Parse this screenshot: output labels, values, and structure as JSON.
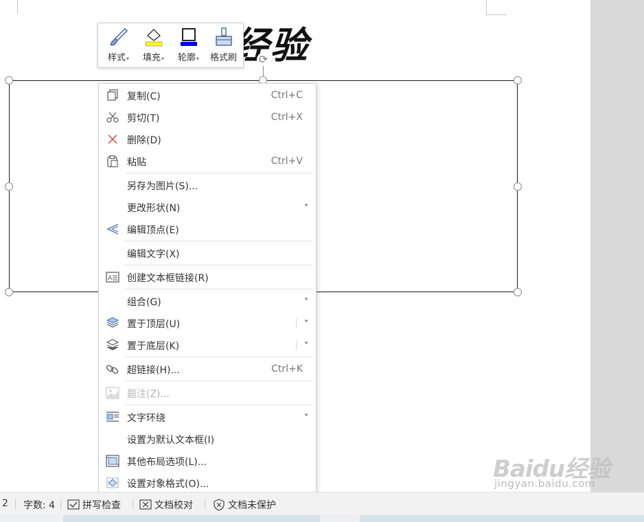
{
  "document": {
    "title_fragment": "经验"
  },
  "mini_toolbar": {
    "buttons": [
      {
        "label": "样式",
        "icon": "brush-icon",
        "has_caret": true
      },
      {
        "label": "填充",
        "icon": "fill-bucket-icon",
        "has_caret": true,
        "accent": "#ffff00"
      },
      {
        "label": "轮廓",
        "icon": "outline-icon",
        "has_caret": true,
        "accent": "#0000ff"
      },
      {
        "label": "格式刷",
        "icon": "format-painter-icon",
        "has_caret": false
      }
    ],
    "caret_glyph": "▾"
  },
  "context_menu": {
    "items": [
      {
        "label": "复制(C)",
        "shortcut": "Ctrl+C",
        "icon": "copy-icon"
      },
      {
        "label": "剪切(T)",
        "shortcut": "Ctrl+X",
        "icon": "scissors-icon"
      },
      {
        "label": "删除(D)",
        "shortcut": "",
        "icon": "delete-x-icon",
        "icon_color": "#e04040"
      },
      {
        "label": "粘贴",
        "shortcut": "Ctrl+V",
        "icon": "paste-icon"
      },
      {
        "label": "另存为图片(S)...",
        "shortcut": "",
        "icon": ""
      },
      {
        "label": "更改形状(N)",
        "shortcut": "",
        "icon": "",
        "submenu": true
      },
      {
        "label": "编辑顶点(E)",
        "shortcut": "",
        "icon": "edit-points-icon"
      },
      {
        "label": "编辑文字(X)",
        "shortcut": "",
        "icon": ""
      },
      {
        "label": "创建文本框链接(R)",
        "shortcut": "",
        "icon": "textbox-link-icon"
      },
      {
        "label": "组合(G)",
        "shortcut": "",
        "icon": "",
        "submenu": true
      },
      {
        "label": "置于顶层(U)",
        "shortcut": "",
        "icon": "bring-to-front-icon",
        "submenu": true,
        "split": true
      },
      {
        "label": "置于底层(K)",
        "shortcut": "",
        "icon": "send-to-back-icon",
        "submenu": true,
        "split": true
      },
      {
        "label": "超链接(H)...",
        "shortcut": "Ctrl+K",
        "icon": "hyperlink-icon"
      },
      {
        "label": "题注(Z)...",
        "shortcut": "",
        "icon": "caption-icon",
        "disabled": true
      },
      {
        "label": "文字环绕",
        "shortcut": "",
        "icon": "text-wrap-icon",
        "submenu": true
      },
      {
        "label": "设置为默认文本框(I)",
        "shortcut": "",
        "icon": ""
      },
      {
        "label": "其他布局选项(L)...",
        "shortcut": "",
        "icon": "layout-options-icon"
      },
      {
        "label": "设置对象格式(O)...",
        "shortcut": "",
        "icon": "format-object-icon"
      }
    ],
    "submenu_glyph": "▸"
  },
  "status_bar": {
    "page_indicator": "2",
    "word_count": "字数: 4",
    "spell_check": "拼写检查",
    "doc_proofread": "文档校对",
    "doc_unprotected": "文档未保护"
  },
  "watermark": {
    "logo": "Baidu经验",
    "url": "jingyan.baidu.com"
  },
  "colors": {
    "menu_text": "#333333",
    "shortcut_text": "#777777",
    "disabled_text": "#b3b3b3",
    "delete_red": "#e04040",
    "fill_yellow": "#ffff00",
    "outline_blue": "#0000ff"
  }
}
